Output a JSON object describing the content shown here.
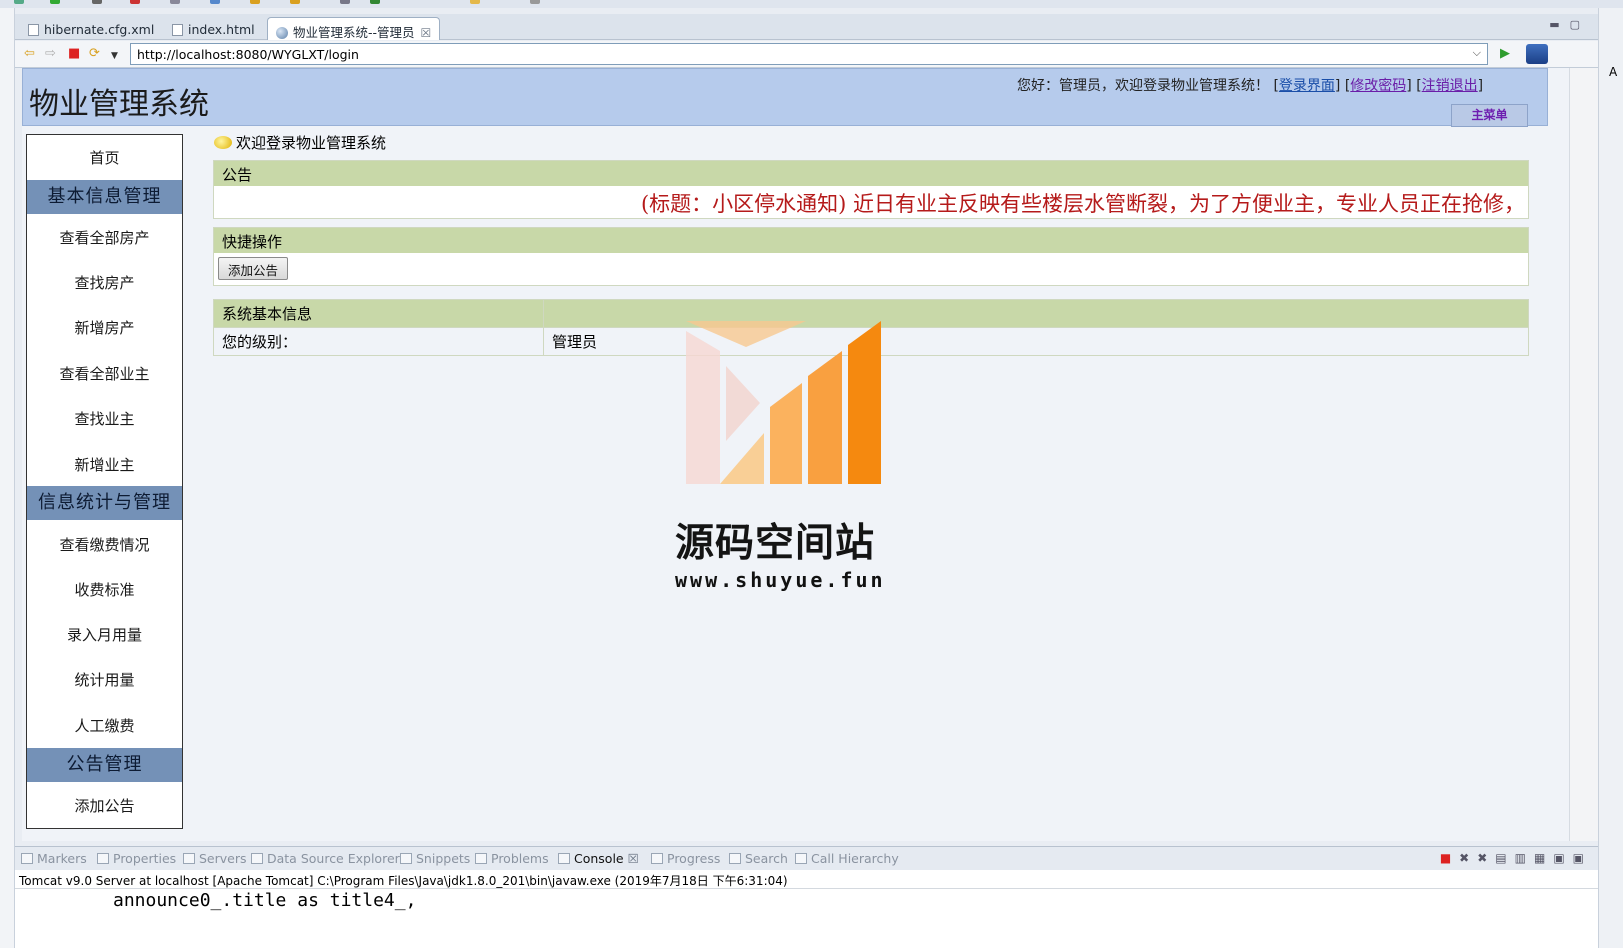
{
  "ide": {
    "tabs": [
      {
        "label": "hibernate.cfg.xml"
      },
      {
        "label": "index.html"
      },
      {
        "label": "物业管理系统--管理员"
      }
    ],
    "url": "http://localhost:8080/WYGLXT/login",
    "bottom_tabs": [
      "Markers",
      "Properties",
      "Servers",
      "Data Source Explorer",
      "Snippets",
      "Problems",
      "Console",
      "Progress",
      "Search",
      "Call Hierarchy"
    ],
    "console_header": "Tomcat v9.0 Server at localhost [Apache Tomcat] C:\\Program Files\\Java\\jdk1.8.0_201\\bin\\javaw.exe (2019年7月18日 下午6:31:04)",
    "console_line": "announce0_.title as title4_,",
    "right_edge_letter": "A"
  },
  "site": {
    "title": "物业管理系统",
    "greeting": "您好：管理员，欢迎登录物业管理系统！",
    "links": {
      "login": "登录界面",
      "change_password": "修改密码",
      "logout": "注销退出"
    },
    "main_menu": "主菜单"
  },
  "sidebar": {
    "home": "首页",
    "sections": [
      {
        "title": "基本信息管理",
        "items": [
          "查看全部房产",
          "查找房产",
          "新增房产",
          "查看全部业主",
          "查找业主",
          "新增业主"
        ]
      },
      {
        "title": "信息统计与管理",
        "items": [
          "查看缴费情况",
          "收费标准",
          "录入月用量",
          "统计用量",
          "人工缴费"
        ]
      },
      {
        "title": "公告管理",
        "items": [
          "添加公告"
        ]
      }
    ]
  },
  "main": {
    "welcome": "欢迎登录物业管理系统",
    "notice_header": "公告",
    "notice_text": "(标题：小区停水通知) 近日有业主反映有些楼层水管断裂，为了方便业主，专业人员正在抢修，",
    "quick_header": "快捷操作",
    "quick_button": "添加公告",
    "info_header": "系统基本信息",
    "level_label": "您的级别：",
    "level_value": "管理员"
  },
  "watermark": {
    "name": "源码空间站",
    "url": "www.shuyue.fun"
  }
}
